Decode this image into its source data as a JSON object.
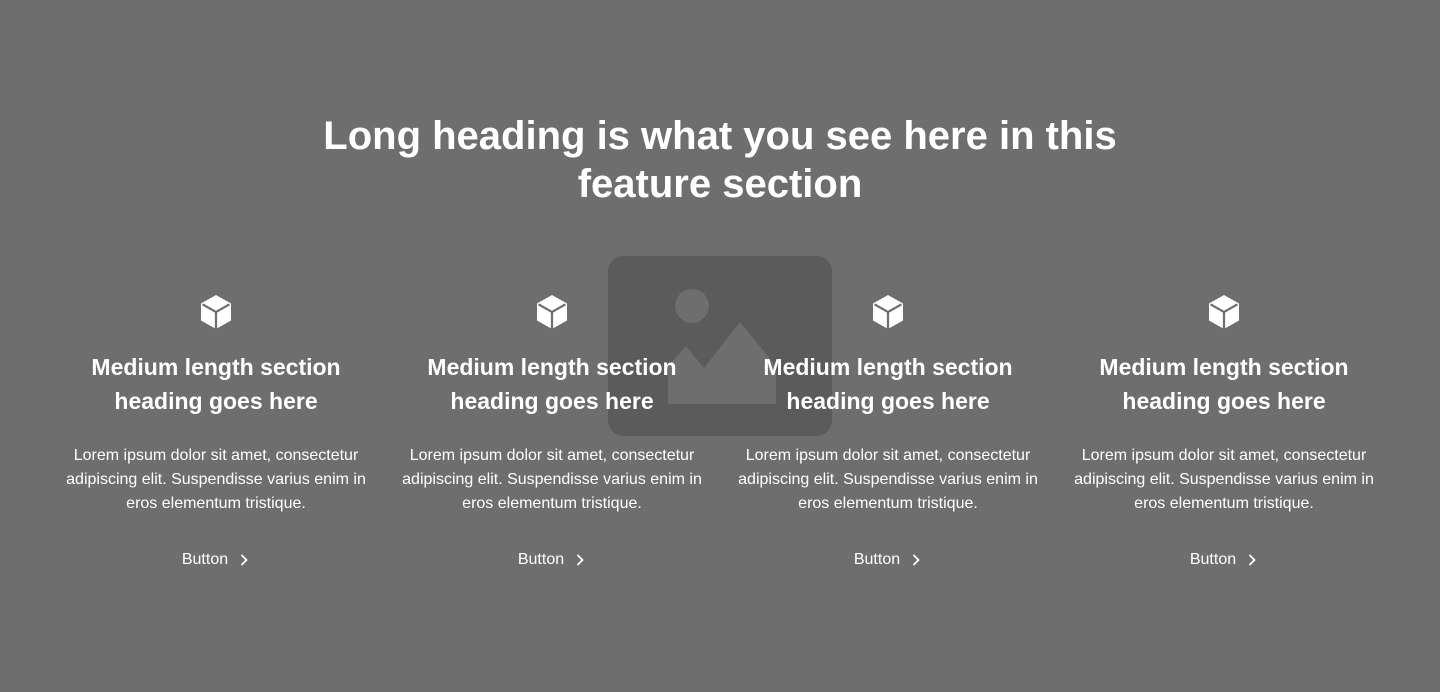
{
  "section": {
    "heading": "Long heading is what you see here in this feature section"
  },
  "background_image": {
    "icon": "image-placeholder-icon"
  },
  "features": [
    {
      "icon": "cube-icon",
      "title": "Medium length section heading goes here",
      "text": "Lorem ipsum dolor sit amet, consectetur adipiscing elit. Suspendisse varius enim in eros elementum tristique.",
      "button_label": "Button"
    },
    {
      "icon": "cube-icon",
      "title": "Medium length section heading goes here",
      "text": "Lorem ipsum dolor sit amet, consectetur adipiscing elit. Suspendisse varius enim in eros elementum tristique.",
      "button_label": "Button"
    },
    {
      "icon": "cube-icon",
      "title": "Medium length section heading goes here",
      "text": "Lorem ipsum dolor sit amet, consectetur adipiscing elit. Suspendisse varius enim in eros elementum tristique.",
      "button_label": "Button"
    },
    {
      "icon": "cube-icon",
      "title": "Medium length section heading goes here",
      "text": "Lorem ipsum dolor sit amet, consectetur adipiscing elit. Suspendisse varius enim in eros elementum tristique.",
      "button_label": "Button"
    }
  ],
  "colors": {
    "background": "#6e6e6e",
    "placeholder": "#5b5b5b",
    "text": "#ffffff"
  }
}
